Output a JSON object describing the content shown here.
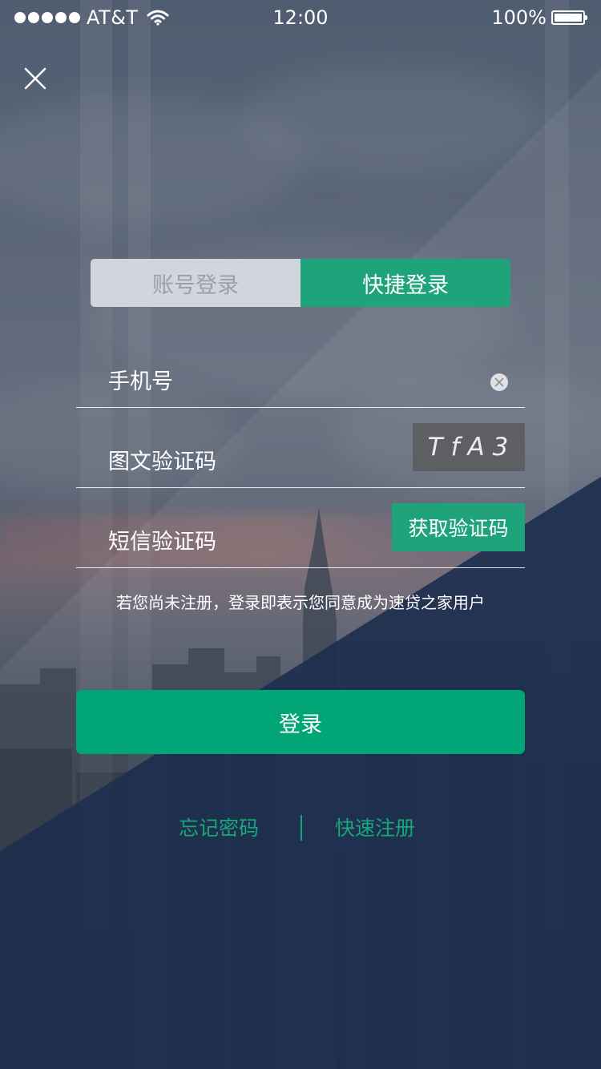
{
  "status_bar": {
    "carrier": "AT&T",
    "time": "12:00",
    "battery": "100%"
  },
  "tabs": [
    {
      "label": "账号登录",
      "active": false
    },
    {
      "label": "快捷登录",
      "active": true
    }
  ],
  "form": {
    "phone_placeholder": "手机号",
    "captcha_placeholder": "图文验证码",
    "captcha_code": "TfA3",
    "sms_placeholder": "短信验证码",
    "sms_button": "获取验证码"
  },
  "agreement_text": "若您尚未注册，登录即表示您同意成为速贷之家用户",
  "login_button": "登录",
  "links": {
    "forgot_password": "忘记密码",
    "quick_register": "快速注册"
  },
  "colors": {
    "accent_green": "#1fa37a",
    "login_green": "#02a575",
    "navy": "#1d2f4f",
    "captcha_bg": "#5d5f62"
  },
  "icons": {
    "close": "close-icon",
    "clear": "clear-input-icon",
    "wifi": "wifi-icon",
    "battery": "battery-icon",
    "signal": "signal-dots-icon"
  }
}
